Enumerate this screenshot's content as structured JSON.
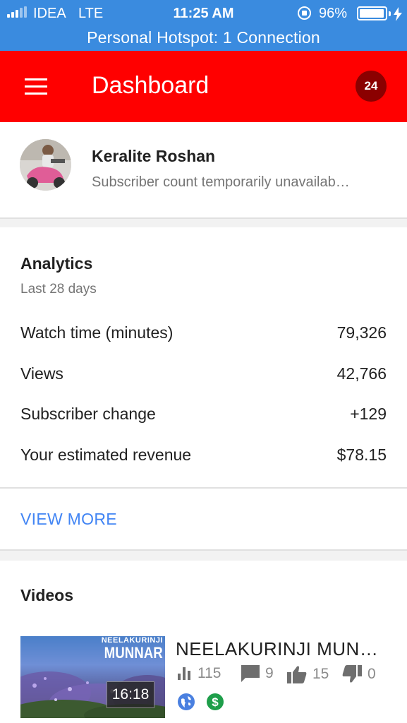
{
  "status_bar": {
    "carrier": "IDEA",
    "network": "LTE",
    "time": "11:25 AM",
    "battery_percent": "96%",
    "battery_level": 0.96,
    "hotspot": "Personal Hotspot: 1 Connection",
    "color": "#3a8bdf"
  },
  "app_bar": {
    "title": "Dashboard",
    "notification_count": "24",
    "color": "#ff0000",
    "badge_color": "#8b0000"
  },
  "channel": {
    "name": "Keralite Roshan",
    "subscriber_status": "Subscriber count temporarily unavailab…"
  },
  "analytics": {
    "title": "Analytics",
    "period": "Last 28 days",
    "metrics": [
      {
        "label": "Watch time (minutes)",
        "value": "79,326"
      },
      {
        "label": "Views",
        "value": "42,766"
      },
      {
        "label": "Subscriber change",
        "value": "+129"
      },
      {
        "label": "Your estimated revenue",
        "value": "$78.15"
      }
    ],
    "view_more": "VIEW MORE",
    "link_color": "#4285f4"
  },
  "videos": {
    "title": "Videos",
    "items": [
      {
        "thumbnail_line1": "NEELAKURINJI",
        "thumbnail_line2": "MUNNAR",
        "duration": "16:18",
        "title": "NEELAKURINJI MUN…",
        "views": "115",
        "comments": "9",
        "likes": "15",
        "dislikes": "0",
        "icons": [
          "globe-icon",
          "dollar-icon"
        ]
      }
    ]
  }
}
